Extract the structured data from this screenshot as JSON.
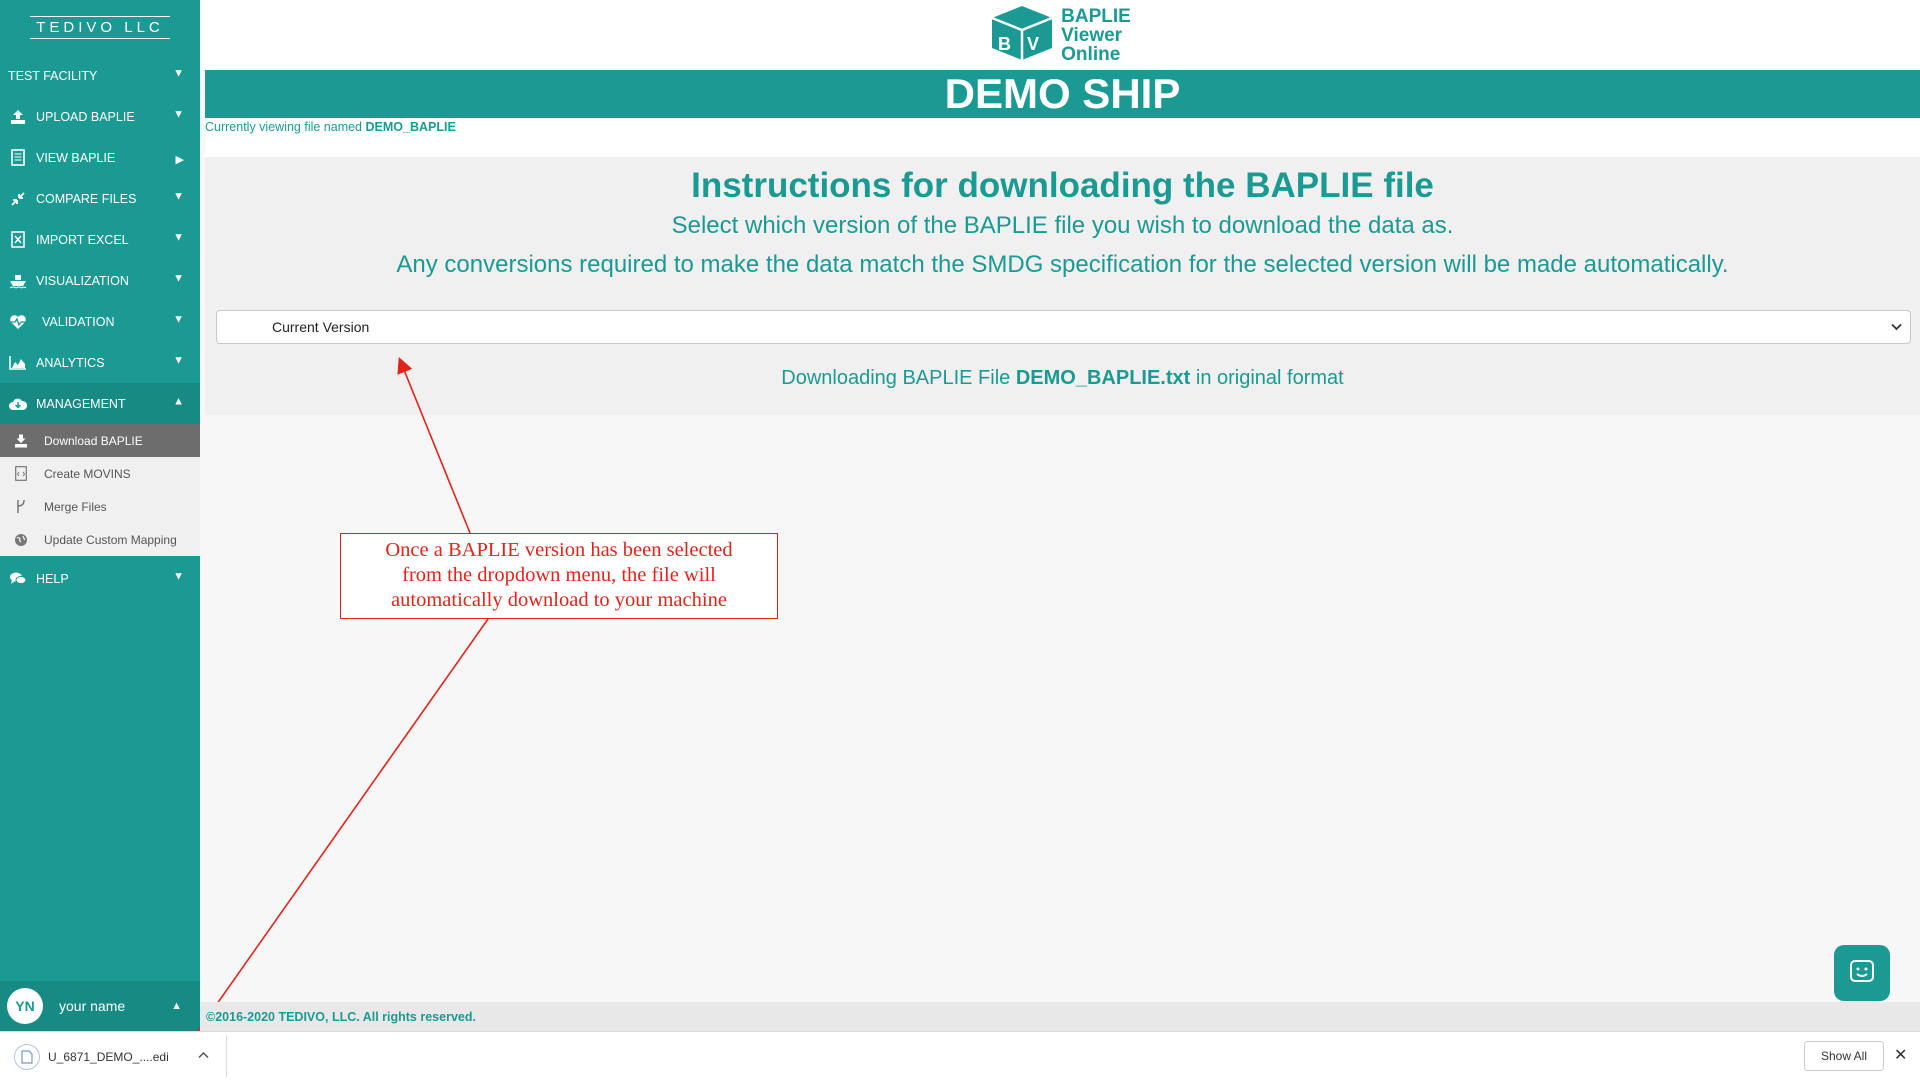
{
  "sidebar": {
    "brand": "TEDIVO LLC",
    "items": [
      {
        "label": "TEST FACILITY"
      },
      {
        "label": "UPLOAD BAPLIE"
      },
      {
        "label": "VIEW BAPLIE"
      },
      {
        "label": "COMPARE FILES"
      },
      {
        "label": "IMPORT EXCEL"
      },
      {
        "label": "VISUALIZATION"
      },
      {
        "label": "VALIDATION"
      },
      {
        "label": "ANALYTICS"
      },
      {
        "label": "MANAGEMENT"
      },
      {
        "label": "HELP"
      }
    ],
    "submenu": [
      {
        "label": "Download BAPLIE"
      },
      {
        "label": "Create MOVINS"
      },
      {
        "label": "Merge Files"
      },
      {
        "label": "Update Custom Mapping"
      }
    ],
    "user": {
      "initials": "YN",
      "name": "your name"
    }
  },
  "logo": {
    "line1": "BAPLIE",
    "line2": "Viewer",
    "line3": "Online"
  },
  "ship_name": "DEMO SHIP",
  "viewing": {
    "prefix": "Currently viewing file named",
    "file": "DEMO_BAPLIE"
  },
  "instructions": {
    "title": "Instructions for downloading the BAPLIE file",
    "subtitle": "Select which version of the BAPLIE file you wish to download the data as.",
    "subtitle2": "Any conversions required to make the data match the SMDG specification for the selected version will be made automatically.",
    "select_value": "Current Version",
    "note_prefix": "Downloading BAPLIE File",
    "note_file": "DEMO_BAPLIE.txt",
    "note_suffix": "in original format"
  },
  "callout": {
    "line1": "Once a BAPLIE version has been selected",
    "line2": "from the dropdown menu, the file will",
    "line3": "automatically download to your machine"
  },
  "footer": "©2016-2020 TEDIVO, LLC. All rights reserved.",
  "download_bar": {
    "filename": "U_6871_DEMO_....edi",
    "show_all": "Show All"
  },
  "colors": {
    "primary": "#1a9a93",
    "annotation": "#e2231a"
  }
}
